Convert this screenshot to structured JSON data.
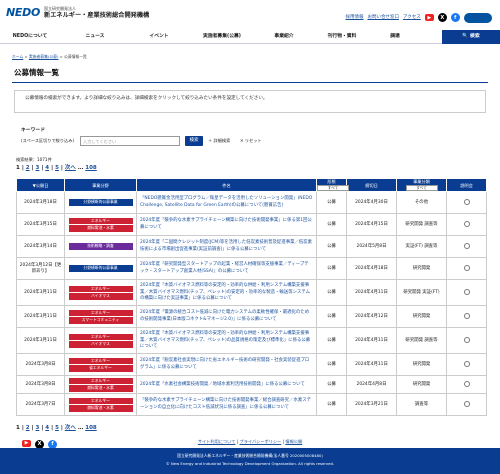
{
  "header": {
    "logo_mark": "NEDO",
    "org_small": "国立研究開発法人",
    "org_name": "新エネルギー・産業技術総合開発機構",
    "util_links": [
      "採用情報",
      "お問い合せ窓口",
      "アクセス"
    ],
    "english": "English"
  },
  "nav": {
    "items": [
      "NEDOについて",
      "ニュース",
      "イベント",
      "実施者募集(公募)",
      "事業紹介",
      "刊行物・資料",
      "調達"
    ],
    "search": "検索"
  },
  "breadcrumb": [
    "ホーム",
    "実施者募集(公募)",
    "公募情報一覧"
  ],
  "page": {
    "title": "公募情報一覧",
    "intro": "公募情報の検索ができます。より詳細な絞り込みは、詳細検索をクリックして絞り込みたい条件を設定してください。"
  },
  "search": {
    "label": "キーワード",
    "sublabel": "(スペース区切りで絞り込み)",
    "placeholder": "入力してください",
    "button": "検索",
    "detail": "詳細検索",
    "reset": "リセット"
  },
  "results": {
    "count": "検索結果：1071件",
    "pages": [
      "1",
      "2",
      "3",
      "4",
      "5",
      "次へ",
      "108"
    ],
    "columns": {
      "date": "公開日",
      "field": "事業分野",
      "name": "件名",
      "type": "形態",
      "deadline": "締切日",
      "status": "事業分類",
      "status_sel": "すべて",
      "bookmark": "説明会"
    },
    "type_sel": "すべて",
    "rows": [
      {
        "date": "2024年3月18日",
        "tags": [
          [
            "blue",
            "分野横断的公募事業"
          ]
        ],
        "name": "「NEDO懸賞金活用型プログラム／衛星データを活用したソリューション開発」(NEDO Challenge, Satellite Data for Green Earth)の公募について(懸賞広告)",
        "type": "公募",
        "deadline": "2024年4月30日",
        "status": "その他"
      },
      {
        "date": "2024年3月15日",
        "tags": [
          [
            "red",
            "エネルギー"
          ],
          [
            "red",
            "燃料電池・水素"
          ]
        ],
        "name": "2024年度「競争的な水素サプライチェーン構築に向けた技術開発事業」に係る第1回公募について",
        "type": "公募",
        "deadline": "2024年4月15日",
        "status": "研究開発 調査等"
      },
      {
        "date": "2024年3月14日",
        "tags": [
          [
            "purple",
            "技術戦略・調査"
          ]
        ],
        "name": "2024年度「二国間クレジット制度(JCM)等を活用した低炭素技術普及促進事業／低炭素技術による市場創出促進事業(実証前調査)」に係る公募について",
        "type": "公募",
        "deadline": "2024年5月8日",
        "status": "実証(FT) 調査等"
      },
      {
        "date": "2024年3月12日【更新あり】",
        "tags": [
          [
            "blue",
            "分野横断的公募事業"
          ]
        ],
        "name": "2024年度「研究開発型スタートアップの起業・経営人材確保等支援事業／ディープテック・スタートアップ創業人材(SSA)」の公募について",
        "type": "公募",
        "deadline": "2024年4月18日",
        "status": "研究開発"
      },
      {
        "date": "2024年3月11日",
        "tags": [
          [
            "red",
            "エネルギー"
          ],
          [
            "red",
            "バイオマス"
          ]
        ],
        "name": "2024年度「木質バイオマス燃料等の安定的・効率的な供給・利用システム構築支援事業／木質バイオマス燃料(チップ、ペレット)の安定的・効率的な製造・輸送等システムの構築に向けた実証事業」に係る公募について",
        "type": "公募",
        "deadline": "2024年4月11日",
        "status": "研究開発 実証(FT)"
      },
      {
        "date": "2024年3月11日",
        "tags": [
          [
            "red",
            "エネルギー"
          ],
          [
            "red",
            "スマートコミュニティ"
          ]
        ],
        "name": "2024年度「電源の統合コスト低減に向けた電力システムの柔軟性確保・最適化のための技術開発事業(日本版コネクト&マネージ2.0)」に係る公募について",
        "type": "公募",
        "deadline": "2024年4月12日",
        "status": "研究開発"
      },
      {
        "date": "2024年3月11日",
        "tags": [
          [
            "red",
            "エネルギー"
          ],
          [
            "red",
            "バイオマス"
          ]
        ],
        "name": "2024年度「木質バイオマス燃料等の安定的・効率的な供給・利用システム構築支援事業／木質バイオマス燃料(チップ、ペレット)の品質規格の策定及び標準化」に係る公募について",
        "type": "公募",
        "deadline": "2024年4月11日",
        "status": "研究開発 調査等"
      },
      {
        "date": "2024年3月8日",
        "tags": [
          [
            "red",
            "エネルギー"
          ],
          [
            "red",
            "省エネルギー"
          ]
        ],
        "name": "2024年度「脱炭素社会実現に向けた省エネルギー技術の研究開発・社会実装促進プログラム」に係る公募について",
        "type": "公募",
        "deadline": "2024年4月11日",
        "status": "研究開発"
      },
      {
        "date": "2024年3月8日",
        "tags": [
          [
            "red",
            "エネルギー"
          ],
          [
            "red",
            "燃料電池・水素"
          ]
        ],
        "name": "2024年度「水素社会構築技術開発／地域水素利活用技術開発」に係る公募について",
        "type": "公募",
        "deadline": "2024年4月8日",
        "status": "研究開発"
      },
      {
        "date": "2024年3月7日",
        "tags": [
          [
            "red",
            "エネルギー"
          ],
          [
            "red",
            "燃料電池・水素"
          ]
        ],
        "name": "「競争的な水素サプライチェーン構築に向けた技術開発事業／総合調査研究／水素ステーションの自立化に向けたコスト低減状況に係る調査」に係る公募について",
        "type": "公募",
        "deadline": "2024年3月21日",
        "status": "調査等"
      }
    ]
  },
  "footer": {
    "links": [
      "サイト利用について",
      "プライバシーポリシー",
      "情報公開"
    ],
    "org": "国立研究開発法人新エネルギー・産業技術総合開発機構(法人番号 2020005008480)",
    "org_en": "© New Energy and Industrial Technology Development Organization. All rights reserved."
  },
  "colors": {
    "primary": "#0a3d91",
    "tag_energy": "#cc2233",
    "tag_strategy": "#6a2b9b"
  }
}
